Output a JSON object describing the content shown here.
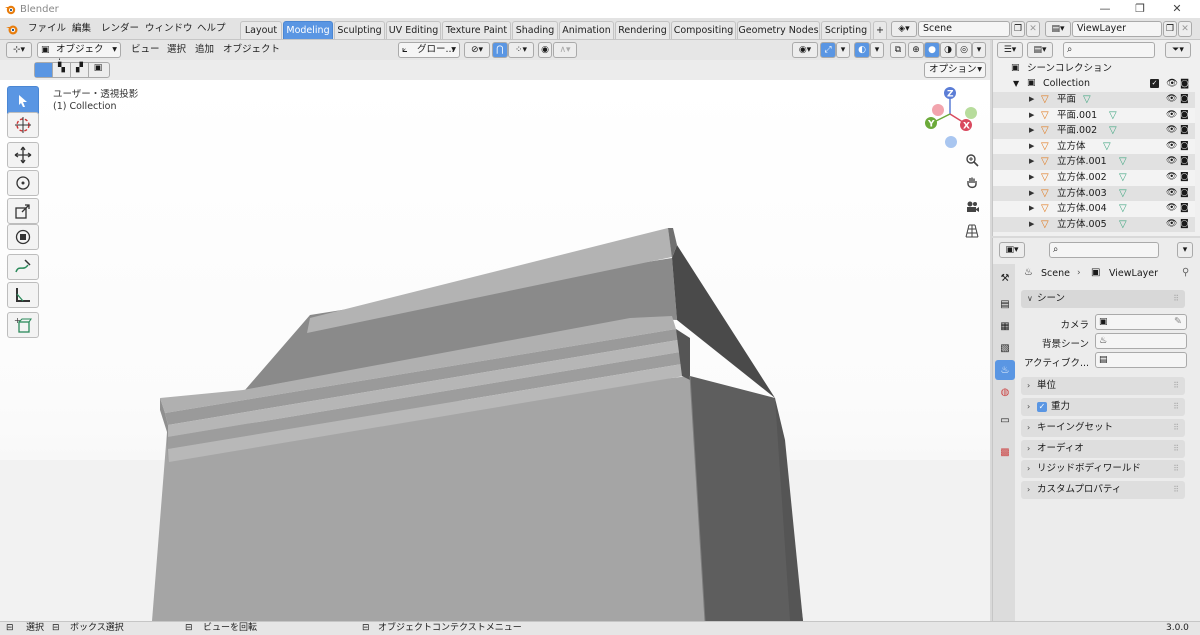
{
  "window": {
    "title": "Blender"
  },
  "menu": {
    "file": "ファイル",
    "edit": "編集",
    "render": "レンダー",
    "window": "ウィンドウ",
    "help": "ヘルプ"
  },
  "workspaces": [
    {
      "label": "Layout",
      "active": false
    },
    {
      "label": "Modeling",
      "active": true
    },
    {
      "label": "Sculpting",
      "active": false
    },
    {
      "label": "UV Editing",
      "active": false
    },
    {
      "label": "Texture Paint",
      "active": false
    },
    {
      "label": "Shading",
      "active": false
    },
    {
      "label": "Animation",
      "active": false
    },
    {
      "label": "Rendering",
      "active": false
    },
    {
      "label": "Compositing",
      "active": false
    },
    {
      "label": "Geometry Nodes",
      "active": false
    },
    {
      "label": "Scripting",
      "active": false
    }
  ],
  "scene_field": "Scene",
  "viewlayer_field": "ViewLayer",
  "viewport_header": {
    "mode": "オブジェクト...",
    "view": "ビュー",
    "select": "選択",
    "add": "追加",
    "object": "オブジェクト",
    "transform_orientation": "グロー...",
    "options": "オプション"
  },
  "viewport": {
    "view_name": "ユーザー・透視投影",
    "collection_info": "(1) Collection",
    "gizmo": {
      "z": "Z",
      "y": "Y",
      "x": "X"
    }
  },
  "outliner": {
    "root": "シーンコレクション",
    "collection": "Collection",
    "items": [
      "平面",
      "平面.001",
      "平面.002",
      "立方体",
      "立方体.001",
      "立方体.002",
      "立方体.003",
      "立方体.004",
      "立方体.005"
    ]
  },
  "properties": {
    "breadcrumb_scene": "Scene",
    "breadcrumb_viewlayer": "ViewLayer",
    "scene_section": "シーン",
    "camera_label": "カメラ",
    "background_label": "背景シーン",
    "active_clip_label": "アクティブク...",
    "sections": {
      "units": "単位",
      "gravity": "重力",
      "keying": "キーイングセット",
      "audio": "オーディオ",
      "rigidbody": "リジッドボディワールド",
      "custom": "カスタムプロパティ"
    },
    "gravity_checked": true
  },
  "statusbar": {
    "select": "選択",
    "box_select": "ボックス選択",
    "rotate_view": "ビューを回転",
    "context_menu": "オブジェクトコンテクストメニュー",
    "version": "3.0.0"
  },
  "colors": {
    "accent": "#5a96e3",
    "object_orange": "#e07a1f",
    "mesh_green": "#3fa680"
  }
}
